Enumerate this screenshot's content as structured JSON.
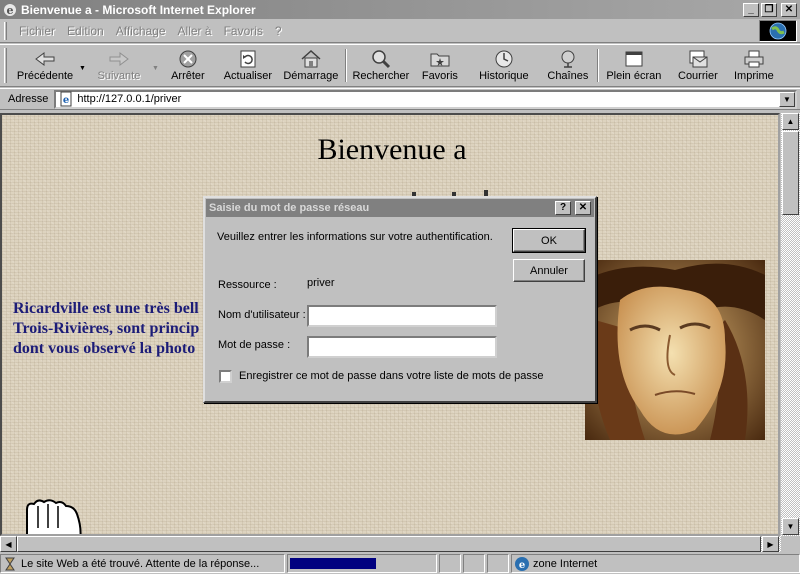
{
  "window": {
    "title": "Bienvenue a - Microsoft Internet Explorer",
    "controls": {
      "minimize": "_",
      "maximize": "❐",
      "close": "✕"
    }
  },
  "menu": [
    {
      "label": "Fichier"
    },
    {
      "label": "Edition"
    },
    {
      "label": "Affichage"
    },
    {
      "label": "Aller à"
    },
    {
      "label": "Favoris"
    },
    {
      "label": "?"
    }
  ],
  "toolbar": {
    "buttons": [
      {
        "label": "Précédente",
        "icon": "back-arrow-icon",
        "enabled": true
      },
      {
        "label": "Suivante",
        "icon": "forward-arrow-icon",
        "enabled": false
      },
      {
        "label": "Arrêter",
        "icon": "stop-icon",
        "enabled": true
      },
      {
        "label": "Actualiser",
        "icon": "refresh-icon",
        "enabled": true
      },
      {
        "label": "Démarrage",
        "icon": "home-icon",
        "enabled": true
      },
      {
        "label": "Rechercher",
        "icon": "search-icon",
        "enabled": true
      },
      {
        "label": "Favoris",
        "icon": "favorites-icon",
        "enabled": true
      },
      {
        "label": "Historique",
        "icon": "history-icon",
        "enabled": true
      },
      {
        "label": "Chaînes",
        "icon": "channels-icon",
        "enabled": true
      },
      {
        "label": "Plein écran",
        "icon": "fullscreen-icon",
        "enabled": true
      },
      {
        "label": "Courrier",
        "icon": "mail-icon",
        "enabled": true
      },
      {
        "label": "Imprime",
        "icon": "print-icon",
        "enabled": true
      }
    ]
  },
  "address": {
    "label": "Adresse",
    "url": "http://127.0.0.1/priver"
  },
  "page": {
    "heading": "Bienvenue a",
    "intro_lines": [
      "Ricardville est une très bell",
      "Trois-Rivières, sont princip",
      "dont vous observé la photo"
    ]
  },
  "dialog": {
    "title": "Saisie du mot de passe réseau",
    "help_button": "?",
    "close_button": "✕",
    "message": "Veuillez entrer les informations sur votre authentification.",
    "ok_label": "OK",
    "cancel_label": "Annuler",
    "resource_label": "Ressource :",
    "resource_value": "priver",
    "username_label": "Nom d'utilisateur :",
    "username_value": "",
    "password_label": "Mot de passe :",
    "password_value": "",
    "save_password_label": "Enregistrer ce mot de passe dans votre liste de mots de passe",
    "save_password_checked": false
  },
  "status": {
    "text": "Le site Web a été trouvé. Attente de la réponse...",
    "progress": 0.6,
    "zone": "zone Internet"
  }
}
